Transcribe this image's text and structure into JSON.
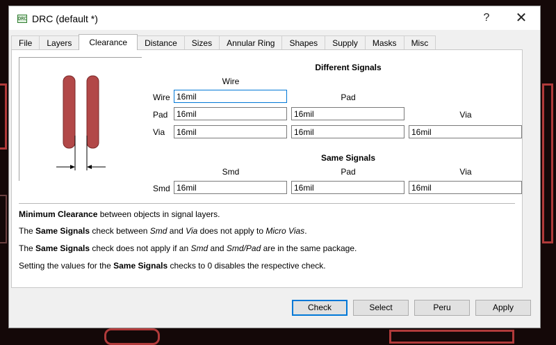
{
  "window": {
    "title": "DRC (default *)",
    "help_glyph": "?",
    "close_glyph": "✕",
    "app_icon_text": "DRC"
  },
  "tabs": [
    {
      "label": "File",
      "active": false
    },
    {
      "label": "Layers",
      "active": false
    },
    {
      "label": "Clearance",
      "active": true
    },
    {
      "label": "Distance",
      "active": false
    },
    {
      "label": "Sizes",
      "active": false
    },
    {
      "label": "Annular Ring",
      "active": false
    },
    {
      "label": "Shapes",
      "active": false
    },
    {
      "label": "Supply",
      "active": false
    },
    {
      "label": "Masks",
      "active": false
    },
    {
      "label": "Misc",
      "active": false
    }
  ],
  "different_signals": {
    "title": "Different Signals",
    "col_wire": "Wire",
    "col_pad": "Pad",
    "col_via": "Via",
    "row_wire": "Wire",
    "row_pad": "Pad",
    "row_via": "Via",
    "wire_wire": "16mil",
    "pad_wire": "16mil",
    "pad_pad": "16mil",
    "via_wire": "16mil",
    "via_pad": "16mil",
    "via_via": "16mil"
  },
  "same_signals": {
    "title": "Same Signals",
    "col_smd": "Smd",
    "col_pad": "Pad",
    "col_via": "Via",
    "row_smd": "Smd",
    "smd_smd": "16mil",
    "smd_pad": "16mil",
    "smd_via": "16mil"
  },
  "info": {
    "line1": {
      "b1": "Minimum Clearance",
      "t1": " between objects in signal layers."
    },
    "line2": {
      "t1": "The ",
      "b1": "Same Signals",
      "t2": " check between ",
      "i1": "Smd",
      "t3": " and ",
      "i2": "Via",
      "t4": " does not apply to ",
      "i3": "Micro Vias",
      "t5": "."
    },
    "line3": {
      "t1": "The ",
      "b1": "Same Signals",
      "t2": " check does not apply if an ",
      "i1": "Smd",
      "t3": " and ",
      "i2": "Smd/Pad",
      "t4": " are in the same package."
    },
    "line4": {
      "t1": "Setting the values for the ",
      "b1": "Same Signals",
      "t2": " checks to 0 disables the respective check."
    }
  },
  "buttons": {
    "check": "Check",
    "select": "Select",
    "peru": "Peru",
    "apply": "Apply"
  },
  "colors": {
    "wire_fill": "#b24848",
    "wire_stroke": "#7a2a2a",
    "accent": "#0078d7"
  }
}
